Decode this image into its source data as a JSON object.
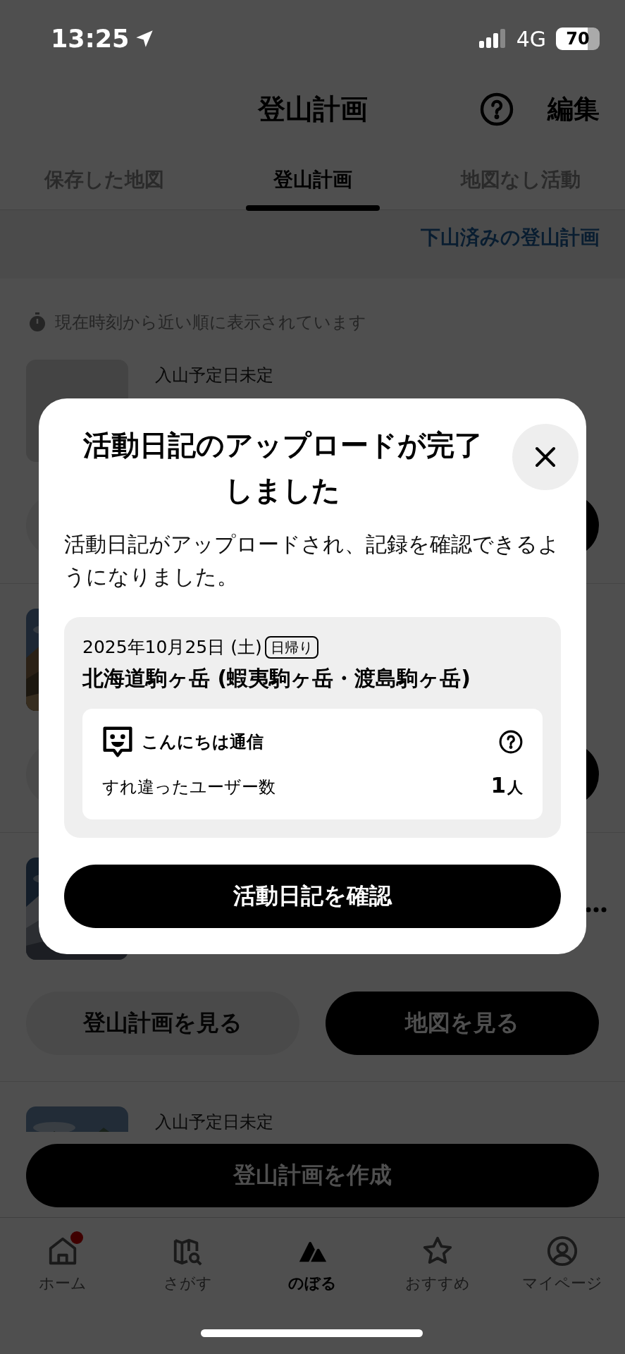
{
  "status_bar": {
    "time": "13:25",
    "network": "4G",
    "battery": "70"
  },
  "header": {
    "title": "登山計画",
    "edit": "編集"
  },
  "tabs": [
    {
      "label": "保存した地図",
      "selected": false
    },
    {
      "label": "登山計画",
      "selected": true
    },
    {
      "label": "地図なし活動",
      "selected": false
    }
  ],
  "completed_link": "下山済みの登山計画",
  "sort_note": "現在時刻から近い順に表示されています",
  "plans": [
    {
      "kind": "placeholder",
      "date": "入山予定日未定",
      "buttons": true
    },
    {
      "kind": "picture",
      "buttons": true
    },
    {
      "kind": "picture",
      "menu": true,
      "view_plan": "登山計画を見る",
      "view_map": "地図を見る"
    },
    {
      "kind": "picture",
      "date": "入山予定日未定"
    }
  ],
  "create_button": "登山計画を作成",
  "nav": [
    {
      "label": "ホーム",
      "kind": "home",
      "badge": true,
      "selected": false
    },
    {
      "label": "さがす",
      "kind": "map",
      "badge": false,
      "selected": false
    },
    {
      "label": "のぼる",
      "kind": "climb",
      "badge": false,
      "selected": true
    },
    {
      "label": "おすすめ",
      "kind": "star",
      "badge": false,
      "selected": false
    },
    {
      "label": "マイページ",
      "kind": "user",
      "badge": false,
      "selected": false
    }
  ],
  "modal": {
    "title": "活動日記のアップロードが完了しました",
    "message": "活動日記がアップロードされ、記録を確認できるようになりました。",
    "activity": {
      "date": "2025年10月25日 (土)",
      "tag": "日帰り",
      "name": "北海道駒ヶ岳 (蝦夷駒ヶ岳・渡島駒ヶ岳)"
    },
    "encounter": {
      "title": "こんにちは通信",
      "label": "すれ違ったユーザー数",
      "count": "1",
      "unit": "人"
    },
    "button": "活動日記を確認"
  }
}
